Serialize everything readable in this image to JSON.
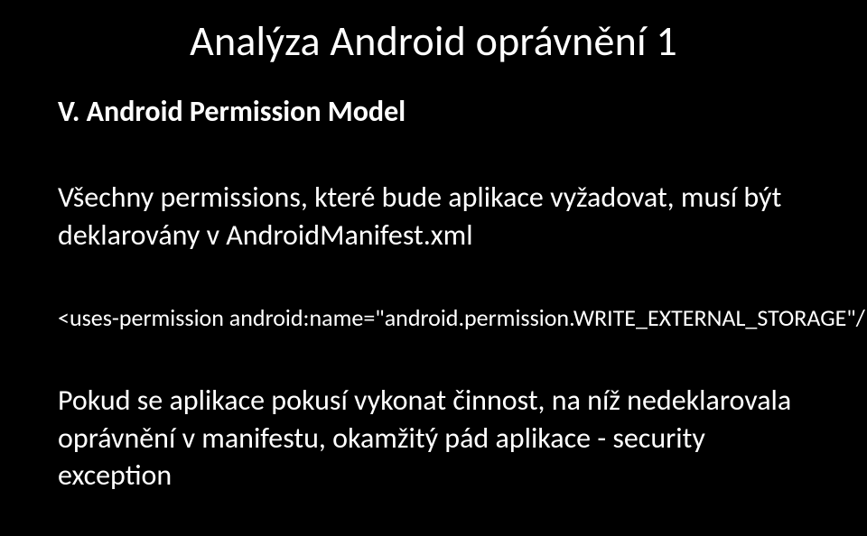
{
  "title": "Analýza Android oprávnění 1",
  "subtitle": "V. Android Permission Model",
  "para1": "Všechny permissions, které bude aplikace vyžadovat, musí být deklarovány v AndroidManifest.xml",
  "code": "<uses-permission android:name=\"android.permission.WRITE_EXTERNAL_STORAGE\"/>",
  "para2": "Pokud se aplikace pokusí vykonat činnost, na níž nedeklarovala oprávnění v manifestu, okamžitý pád aplikace - security exception"
}
